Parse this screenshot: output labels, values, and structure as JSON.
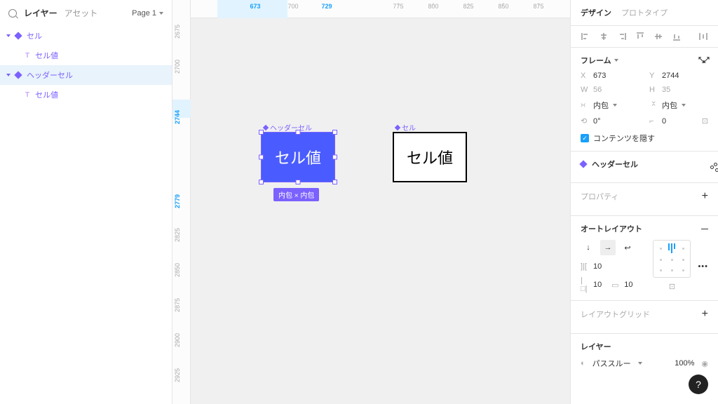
{
  "left": {
    "tab_layers": "レイヤー",
    "tab_assets": "アセット",
    "page_selector": "Page 1",
    "layers": [
      {
        "name": "セル",
        "type": "component"
      },
      {
        "name": "セル値",
        "type": "text",
        "nested": true
      },
      {
        "name": "ヘッダーセル",
        "type": "component",
        "selected": true
      },
      {
        "name": "セル値",
        "type": "text",
        "nested": true
      }
    ]
  },
  "ruler": {
    "h": [
      "673",
      "700",
      "729",
      "775",
      "800",
      "825",
      "850",
      "875"
    ],
    "h_blue_start": "673",
    "h_blue_end": "729",
    "v": [
      "2675",
      "2700",
      "2744",
      "2779",
      "2825",
      "2850",
      "2875",
      "2900",
      "2925"
    ],
    "v_blue_start": "2744",
    "v_blue_end": "2779"
  },
  "canvas": {
    "selected_label": "ヘッダーセル",
    "selected_text": "セル値",
    "plain_label": "セル",
    "plain_text": "セル値",
    "size_badge": "内包 × 内包"
  },
  "right": {
    "tab_design": "デザイン",
    "tab_proto": "プロトタイプ",
    "frame_title": "フレーム",
    "x_label": "X",
    "x_val": "673",
    "y_label": "Y",
    "y_val": "2744",
    "w_label": "W",
    "w_val": "56",
    "h_label": "H",
    "h_val": "35",
    "hug1": "内包",
    "hug2": "内包",
    "rot": "0°",
    "radius": "0",
    "clip_content": "コンテンツを隠す",
    "component_name": "ヘッダーセル",
    "properties": "プロパティ",
    "autolayout": "オートレイアウト",
    "gap": "10",
    "padding_h": "10",
    "padding_v": "10",
    "layout_grid": "レイアウトグリッド",
    "layer_title": "レイヤー",
    "blend": "パススルー",
    "opacity": "100%"
  }
}
